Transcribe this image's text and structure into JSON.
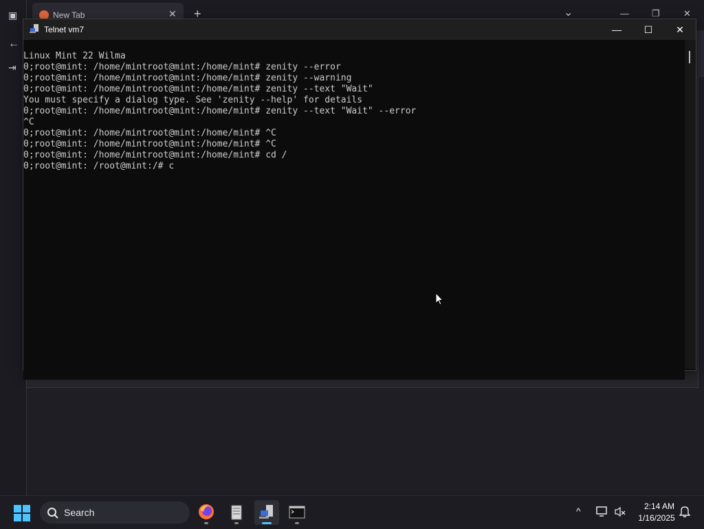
{
  "browser": {
    "tab_title": "New Tab",
    "tab_close": "✕",
    "new_tab": "+",
    "controls": {
      "list": "⌄",
      "minimize": "—",
      "restore": "❐",
      "close": "✕"
    },
    "rail": {
      "tabs": "▣",
      "back": "←",
      "signin": "⇥"
    }
  },
  "window": {
    "title": "Telnet vm7",
    "minimize": "—",
    "maximize": "☐",
    "close": "✕"
  },
  "terminal": {
    "lines": [
      "Linux Mint 22 Wilma",
      "0;root@mint: /home/mintroot@mint:/home/mint# zenity --error",
      "0;root@mint: /home/mintroot@mint:/home/mint# zenity --warning",
      "0;root@mint: /home/mintroot@mint:/home/mint# zenity --text \"Wait\"",
      "You must specify a dialog type. See 'zenity --help' for details",
      "0;root@mint: /home/mintroot@mint:/home/mint# zenity --text \"Wait\" --error",
      "^C",
      "0;root@mint: /home/mintroot@mint:/home/mint# ^C",
      "0;root@mint: /home/mintroot@mint:/home/mint# ^C",
      "0;root@mint: /home/mintroot@mint:/home/mint# cd /",
      "0;root@mint: /root@mint:/# c"
    ]
  },
  "taskbar": {
    "search_label": "Search",
    "apps": [
      "firefox-icon",
      "files-icon",
      "telnet-icon",
      "terminal-icon"
    ],
    "active_app": "telnet-icon",
    "tray": {
      "chevron": "^",
      "network": "🖵",
      "volume": "🔇",
      "notifications": "🔔"
    },
    "time": "2:14 AM",
    "date": "1/16/2025"
  },
  "colors": {
    "terminal_bg": "#0c0c0c",
    "terminal_fg": "#cccccc",
    "taskbar_bg": "#1c1c22",
    "accent": "#4cc2ff"
  }
}
